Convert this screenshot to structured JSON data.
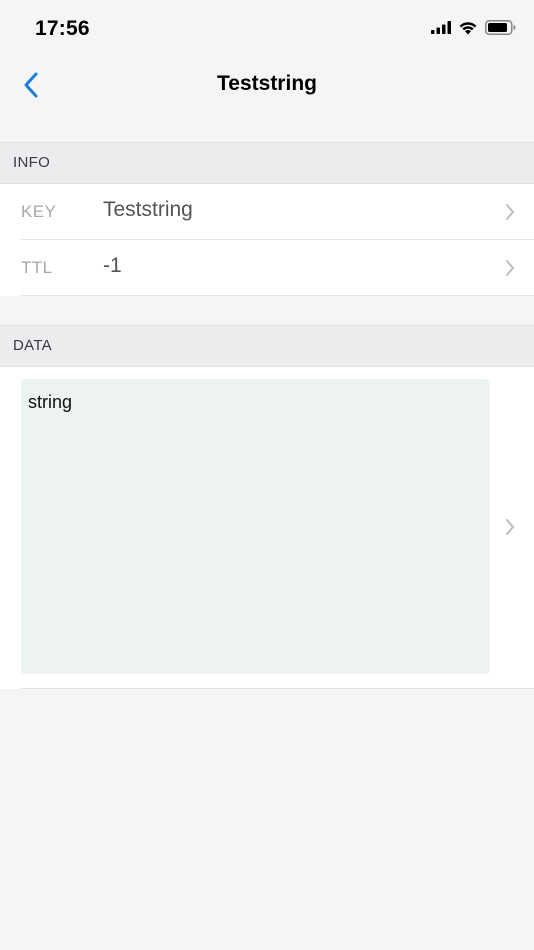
{
  "status_bar": {
    "time": "17:56",
    "icons": [
      "signal-icon",
      "wifi-icon",
      "battery-icon"
    ]
  },
  "nav": {
    "back_icon": "chevron-left-icon",
    "title": "Teststring"
  },
  "sections": {
    "info": {
      "header": "INFO",
      "rows": [
        {
          "label": "KEY",
          "value": "Teststring"
        },
        {
          "label": "TTL",
          "value": "-1"
        }
      ]
    },
    "data": {
      "header": "DATA",
      "value": "string"
    }
  },
  "colors": {
    "accent": "#1a7fd9",
    "background": "#f5f5f5",
    "section_header_bg": "#ececee",
    "data_box_bg": "#edf2f2"
  }
}
